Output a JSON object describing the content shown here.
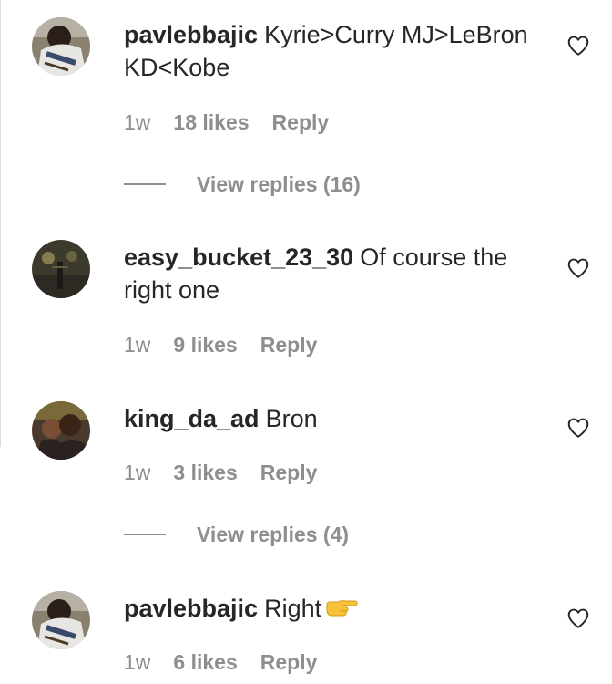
{
  "comments": [
    {
      "username": "pavlebbajic",
      "text": "Kyrie>Curry MJ>LeBron KD<Kobe",
      "time": "1w",
      "likes": "18 likes",
      "reply": "Reply",
      "view_replies": "View replies (16)"
    },
    {
      "username": "easy_bucket_23_30",
      "text": "Of course the right one",
      "time": "1w",
      "likes": "9 likes",
      "reply": "Reply"
    },
    {
      "username": "king_da_ad",
      "text": "Bron",
      "time": "1w",
      "likes": "3 likes",
      "reply": "Reply",
      "view_replies": "View replies (4)"
    },
    {
      "username": "pavlebbajic",
      "text": "Right",
      "emoji": "backhand-index-pointing-right",
      "time": "1w",
      "likes": "6 likes",
      "reply": "Reply"
    }
  ],
  "icons": {
    "like": "heart-outline-icon"
  },
  "colors": {
    "text": "#262626",
    "secondary": "#8e8e8e",
    "border": "#dbdbdb"
  }
}
